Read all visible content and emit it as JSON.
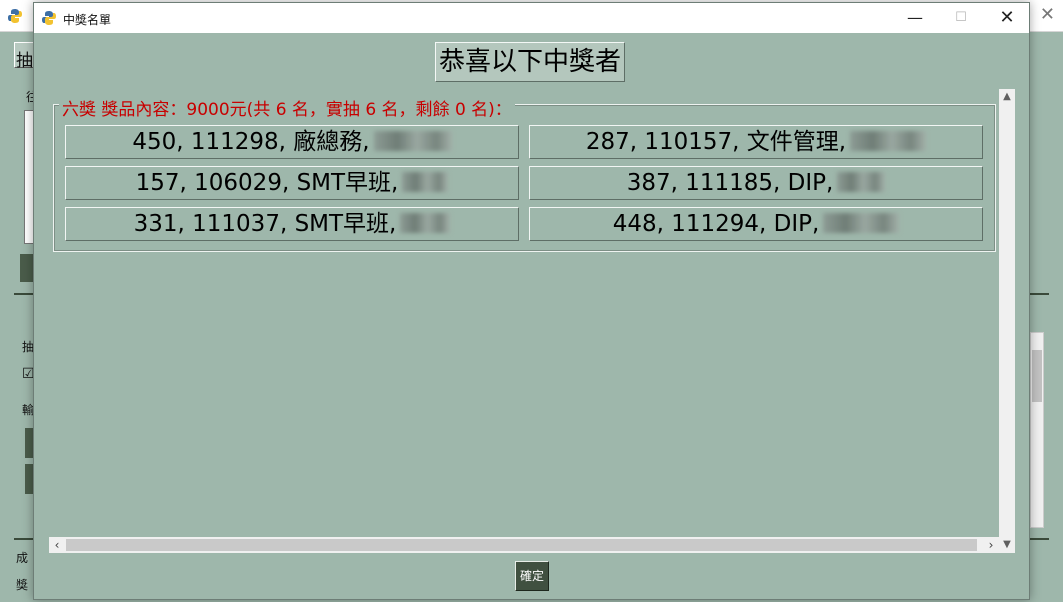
{
  "dialog": {
    "title": "中獎名單",
    "headline": "恭喜以下中獎者",
    "prize_group": {
      "legend": "六獎 獎品內容：9000元(共 6 名，實抽 6 名，剩餘 0 名)：",
      "winners": [
        {
          "text": "450, 111298, 廠總務,"
        },
        {
          "text": "287, 110157, 文件管理,"
        },
        {
          "text": "157, 106029, SMT早班,"
        },
        {
          "text": "387, 111185, DIP,"
        },
        {
          "text": "331, 111037, SMT早班,"
        },
        {
          "text": "448, 111294, DIP,"
        }
      ]
    },
    "ok_button": "確定"
  },
  "background_window": {
    "fragments": [
      "抽",
      "往",
      "抽",
      "☑",
      "輸",
      "成",
      "獎"
    ]
  },
  "icons": {
    "app": "python-icon",
    "minimize": "minimize-icon",
    "maximize": "maximize-icon",
    "close": "close-icon"
  },
  "colors": {
    "window_bg": "#9eb7ab",
    "legend_text": "#c80000",
    "ok_button_bg": "#405040"
  }
}
